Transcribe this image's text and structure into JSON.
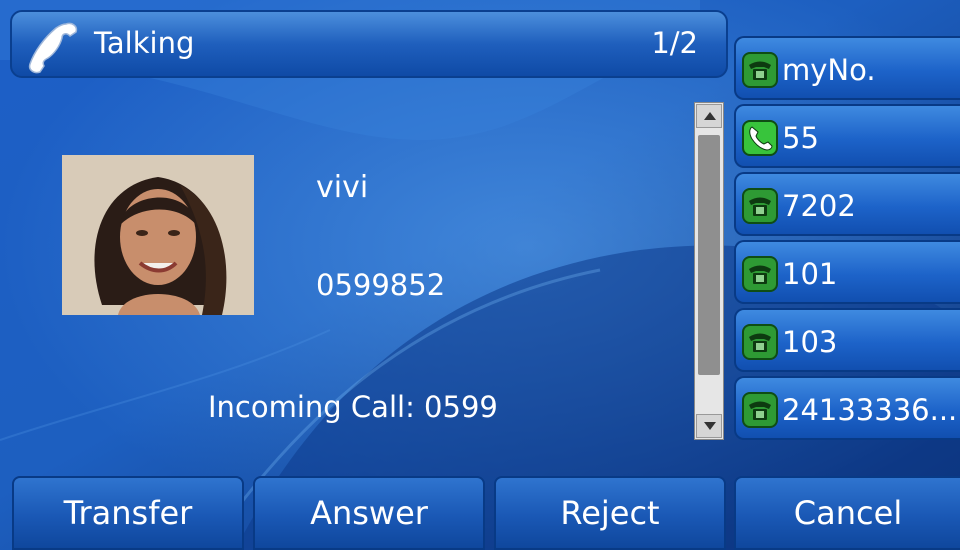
{
  "title_bar": {
    "title": "Talking",
    "page_indicator": "1/2",
    "icon": "handset-icon"
  },
  "contact": {
    "name": "vivi",
    "number": "0599852",
    "photo": "contact-photo"
  },
  "call_status": "Incoming Call: 0599",
  "line_keys": [
    {
      "label": "myNo.",
      "icon": "line-idle-icon",
      "state": "idle"
    },
    {
      "label": "55",
      "icon": "line-active-icon",
      "state": "active"
    },
    {
      "label": "7202",
      "icon": "line-idle-icon",
      "state": "idle"
    },
    {
      "label": "101",
      "icon": "line-idle-icon",
      "state": "idle"
    },
    {
      "label": "103",
      "icon": "line-idle-icon",
      "state": "idle"
    },
    {
      "label": "24133336...",
      "icon": "line-idle-icon",
      "state": "idle"
    }
  ],
  "softkeys": [
    {
      "label": "Transfer"
    },
    {
      "label": "Answer"
    },
    {
      "label": "Reject"
    },
    {
      "label": "Cancel"
    }
  ],
  "colors": {
    "background": "#0a2f78",
    "key_blue": "#1d63c9",
    "idle_icon_green": "#2e9a34",
    "active_icon_green": "#38c43c"
  }
}
